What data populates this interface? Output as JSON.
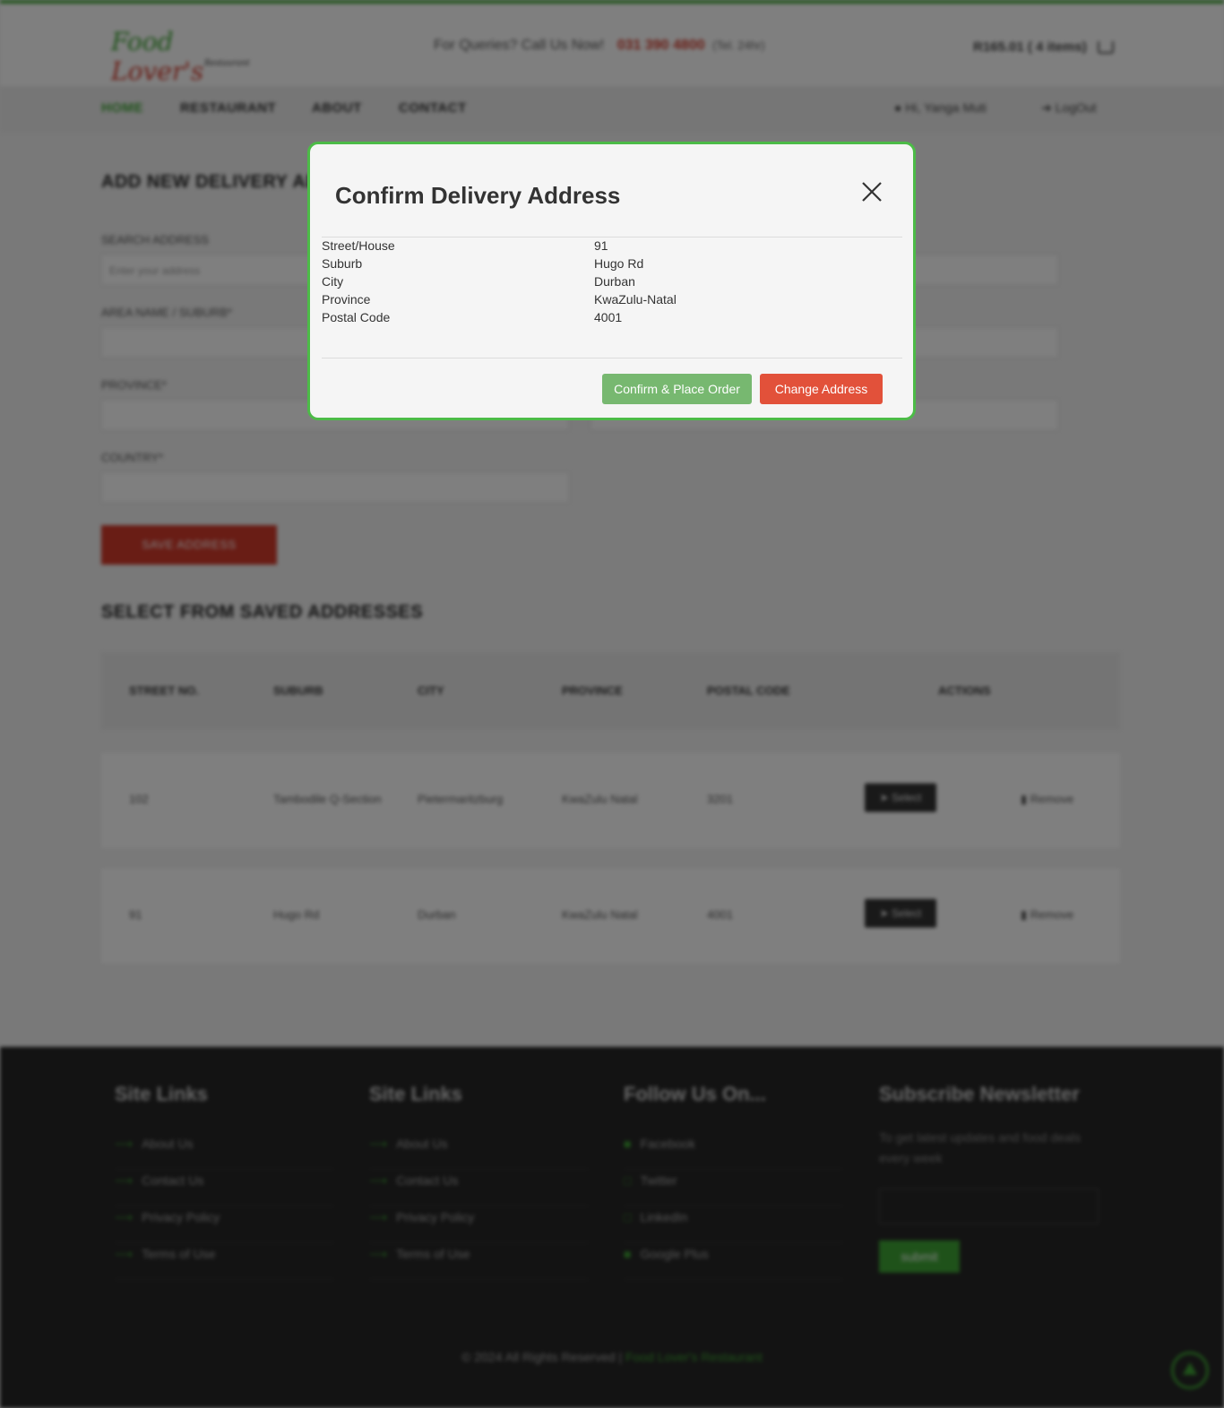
{
  "header": {
    "logo_text_green": "Food",
    "logo_text_red": "Lover's",
    "logo_sub": "Restaurant",
    "contact_prefix": "For Queries? Call Us Now!",
    "phone": "031 390 4800",
    "phone_note": "(Tel. 24hr)",
    "cart_text": "R165.01 ( 4 items)"
  },
  "nav": {
    "items": [
      "HOME",
      "RESTAURANT",
      "ABOUT",
      "CONTACT"
    ],
    "user": "Hi, Yanga Muti",
    "logout": "LogOut"
  },
  "form": {
    "title": "ADD NEW DELIVERY ADDRESS",
    "search_label": "SEARCH ADDRESS",
    "search_placeholder": "Enter your address",
    "area_label": "AREA NAME / SUBURB*",
    "province_label": "PROVINCE*",
    "country_label": "COUNTRY*",
    "save_button": "SAVE ADDRESS"
  },
  "saved": {
    "title": "SELECT FROM SAVED ADDRESSES",
    "columns": [
      "STREET NO.",
      "SUBURB",
      "CITY",
      "PROVINCE",
      "POSTAL CODE",
      "ACTIONS"
    ],
    "rows": [
      {
        "street": "102",
        "suburb": "Tambodile Q-Section",
        "city": "Pietermaritzburg",
        "province": "KwaZulu Natal",
        "postal": "3201",
        "select": "Select",
        "remove": "Remove"
      },
      {
        "street": "91",
        "suburb": "Hugo Rd",
        "city": "Durban",
        "province": "KwaZulu Natal",
        "postal": "4001",
        "select": "Select",
        "remove": "Remove"
      }
    ]
  },
  "footer": {
    "col1_title": "Site Links",
    "col1_links": [
      "About Us",
      "Contact Us",
      "Privacy Policy",
      "Terms of Use"
    ],
    "col2_title": "Site Links",
    "col2_links": [
      "About Us",
      "Contact Us",
      "Privacy Policy",
      "Terms of Use"
    ],
    "col3_title": "Follow Us On...",
    "col3_links": [
      "Facebook",
      "Twitter",
      "LinkedIn",
      "Google Plus"
    ],
    "col4_title": "Subscribe Newsletter",
    "col4_text": "To get latest updates and food deals every week",
    "submit": "submit",
    "copyright": "© 2024 All Rights Reserved |",
    "brand": "Food Lover's Restaurant"
  },
  "modal": {
    "title": "Confirm Delivery Address",
    "rows": [
      {
        "label": "Street/House",
        "value": "91"
      },
      {
        "label": "Suburb",
        "value": "Hugo Rd"
      },
      {
        "label": "City",
        "value": "Durban"
      },
      {
        "label": "Province",
        "value": "KwaZulu-Natal"
      },
      {
        "label": "Postal Code",
        "value": "4001"
      }
    ],
    "confirm_button": "Confirm & Place Order",
    "change_button": "Change Address"
  },
  "colors": {
    "accent_green": "#3fa535",
    "modal_border": "#4cbb47",
    "confirm_bg": "#77b870",
    "change_bg": "#e2513a"
  }
}
